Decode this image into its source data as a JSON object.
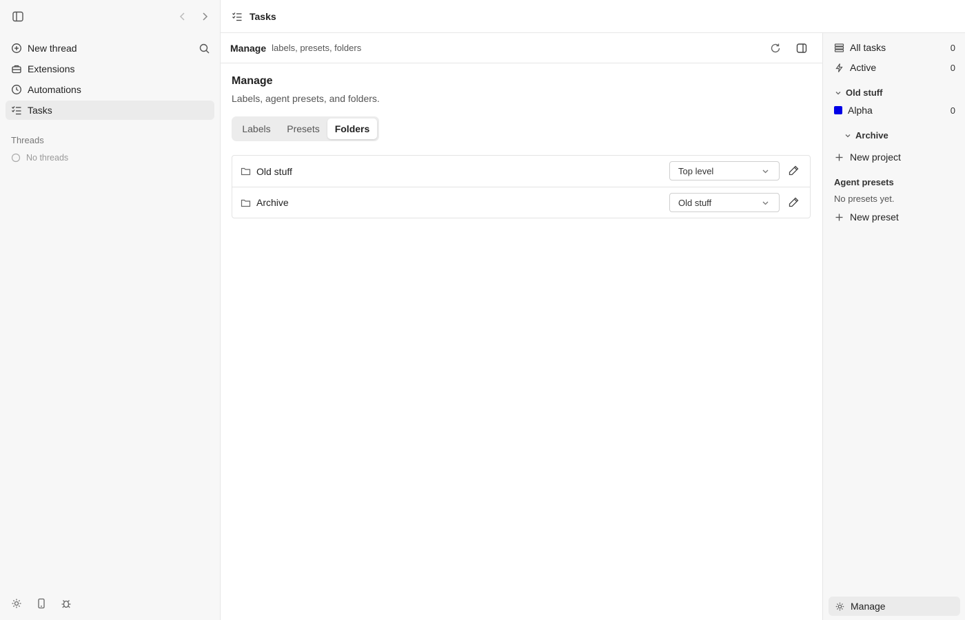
{
  "sidebar": {
    "items": [
      {
        "label": "New thread",
        "icon": "plus-circle-icon"
      },
      {
        "label": "Extensions",
        "icon": "briefcase-icon"
      },
      {
        "label": "Automations",
        "icon": "clock-icon"
      },
      {
        "label": "Tasks",
        "icon": "list-check-icon",
        "active": true
      }
    ],
    "threads_heading": "Threads",
    "threads_empty": "No threads"
  },
  "header": {
    "title": "Tasks"
  },
  "main": {
    "breadcrumb_title": "Manage",
    "breadcrumb_sub": "labels, presets, folders",
    "title": "Manage",
    "subtitle": "Labels, agent presets, and folders.",
    "tabs": [
      {
        "label": "Labels"
      },
      {
        "label": "Presets"
      },
      {
        "label": "Folders",
        "selected": true
      }
    ],
    "folders": [
      {
        "name": "Old stuff",
        "parent": "Top level"
      },
      {
        "name": "Archive",
        "parent": "Old stuff"
      }
    ]
  },
  "right_panel": {
    "all_tasks": {
      "label": "All tasks",
      "count": "0"
    },
    "active": {
      "label": "Active",
      "count": "0"
    },
    "group_old_stuff": "Old stuff",
    "project_alpha": {
      "label": "Alpha",
      "count": "0",
      "color": "#0000e6"
    },
    "group_archive": "Archive",
    "new_project": "New project",
    "presets_heading": "Agent presets",
    "presets_empty": "No presets yet.",
    "new_preset": "New preset",
    "manage": "Manage"
  },
  "colors": {
    "sidebar_bg": "#f7f7f7",
    "active_item_bg": "#ebebeb",
    "project_alpha": "#0000e6"
  }
}
